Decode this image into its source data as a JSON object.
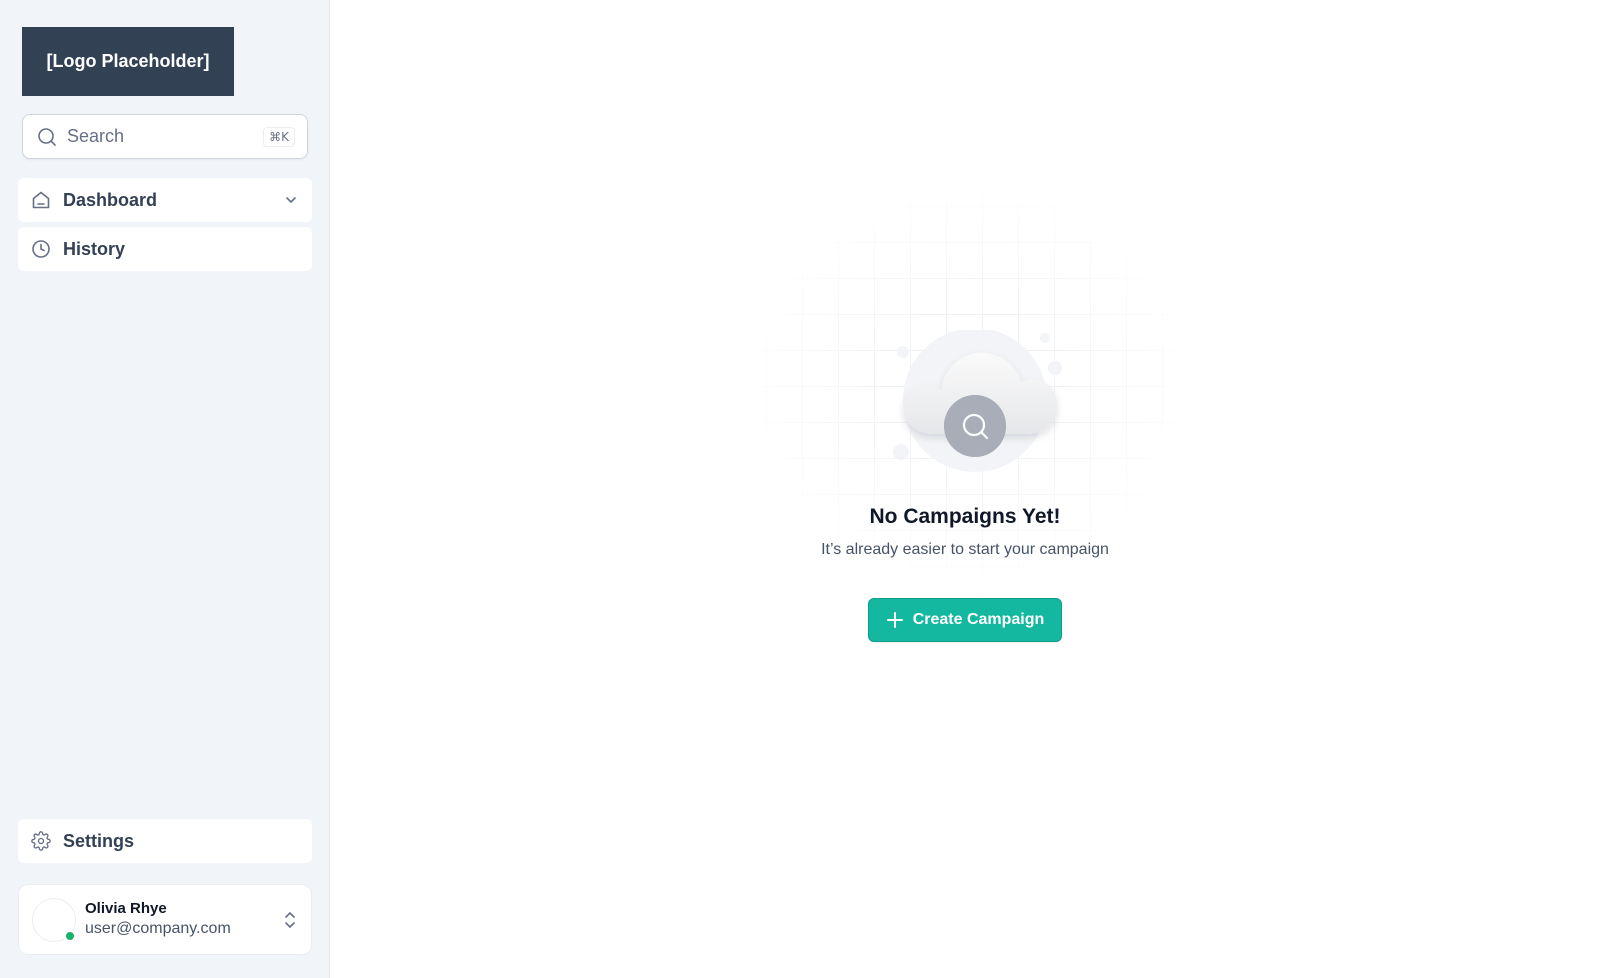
{
  "sidebar": {
    "logo_text": "[Logo Placeholder]",
    "search": {
      "placeholder": "Search",
      "shortcut": "⌘K"
    },
    "nav": [
      {
        "label": "Dashboard",
        "icon": "home-icon",
        "has_chevron": true
      },
      {
        "label": "History",
        "icon": "clock-icon"
      }
    ],
    "settings": {
      "label": "Settings",
      "icon": "gear-icon"
    },
    "user": {
      "name": "Olivia Rhye",
      "email": "user@company.com",
      "status_color": "#17b26a"
    }
  },
  "main": {
    "empty_state": {
      "title": "No Campaigns Yet!",
      "subtitle": "It’s already easier to start your campaign",
      "button_label": "Create Campaign",
      "button_color": "#14b8a0",
      "icon": "cloud-search-illustration"
    }
  }
}
